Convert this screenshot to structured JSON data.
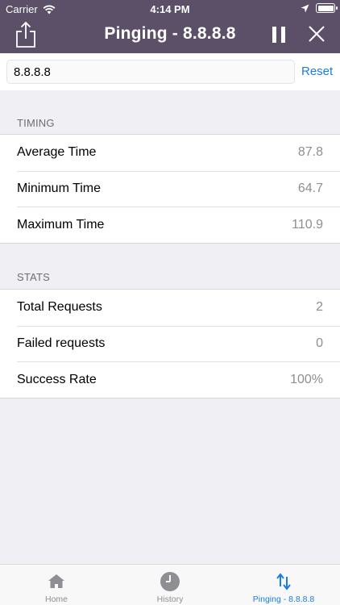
{
  "status_bar": {
    "carrier": "Carrier",
    "time": "4:14 PM"
  },
  "nav": {
    "title": "Pinging - 8.8.8.8",
    "icons": [
      "share-icon",
      "pause-icon",
      "close-icon"
    ]
  },
  "host_input": {
    "value": "8.8.8.8",
    "reset_label": "Reset"
  },
  "sections": {
    "timing": {
      "header": "TIMING",
      "rows": [
        {
          "label": "Average Time",
          "value": "87.8"
        },
        {
          "label": "Minimum Time",
          "value": "64.7"
        },
        {
          "label": "Maximum Time",
          "value": "110.9"
        }
      ]
    },
    "stats": {
      "header": "STATS",
      "rows": [
        {
          "label": "Total Requests",
          "value": "2"
        },
        {
          "label": "Failed requests",
          "value": "0"
        },
        {
          "label": "Success Rate",
          "value": "100%"
        }
      ]
    }
  },
  "tabs": [
    {
      "label": "Home",
      "icon": "home-icon",
      "active": false
    },
    {
      "label": "History",
      "icon": "clock-icon",
      "active": false
    },
    {
      "label": "Pinging - 8.8.8.8",
      "icon": "ping-arrows-icon",
      "active": true
    }
  ],
  "colors": {
    "nav_background": "#5b5068",
    "accent": "#1a7de0",
    "page_background": "#efeff4"
  }
}
